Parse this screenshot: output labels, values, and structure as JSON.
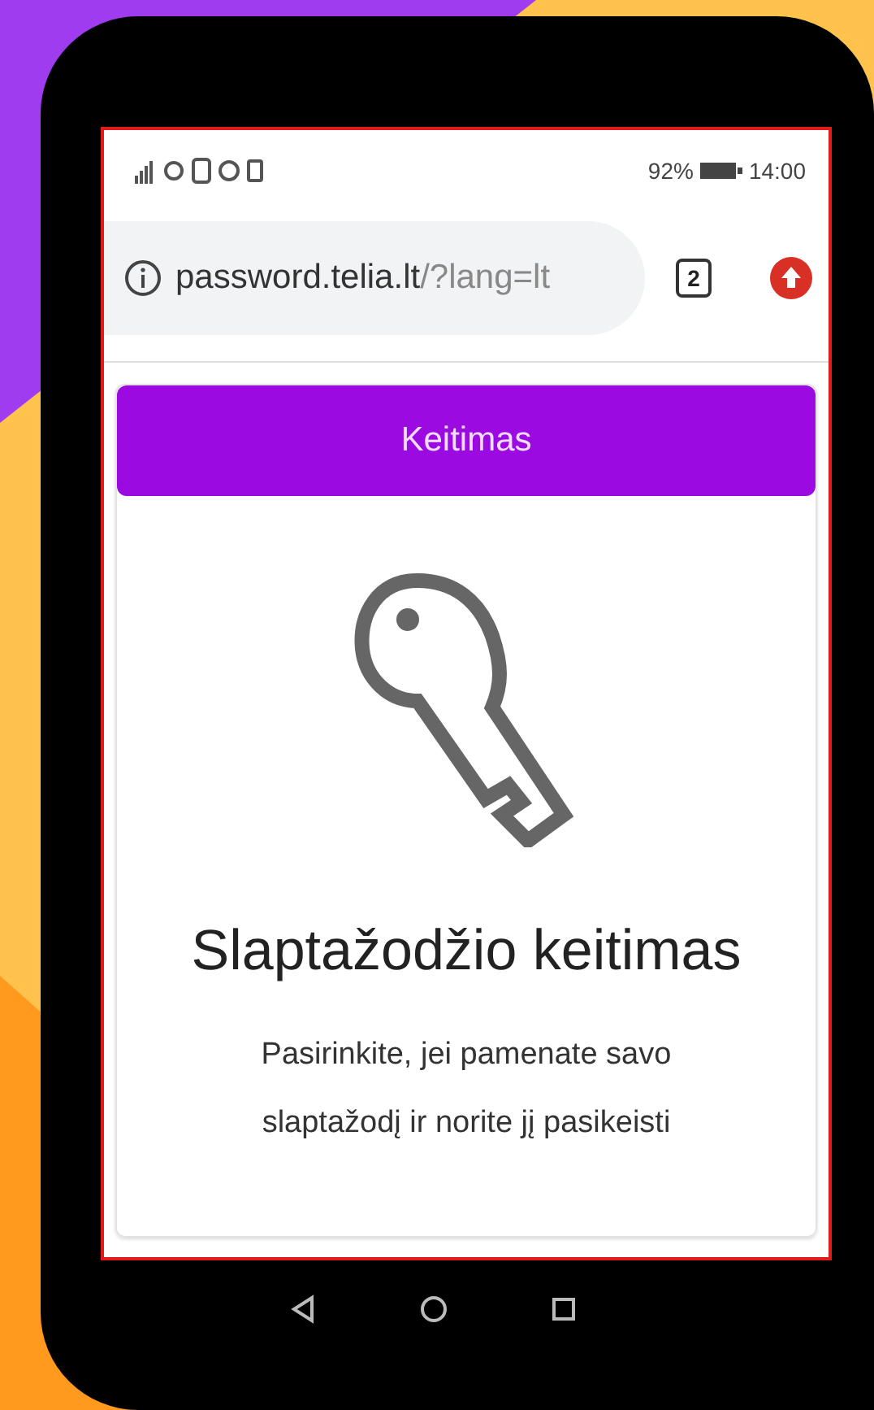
{
  "status_bar": {
    "battery": "92%",
    "time": "14:00"
  },
  "address_bar": {
    "host": "password.telia.lt",
    "path": "/?lang=lt"
  },
  "tab_count": "2",
  "card": {
    "header": "Keitimas",
    "title": "Slaptažodžio keitimas",
    "description": "Pasirinkite, jei pamenate savo slaptažodį ir norite jį pasikeisti"
  }
}
